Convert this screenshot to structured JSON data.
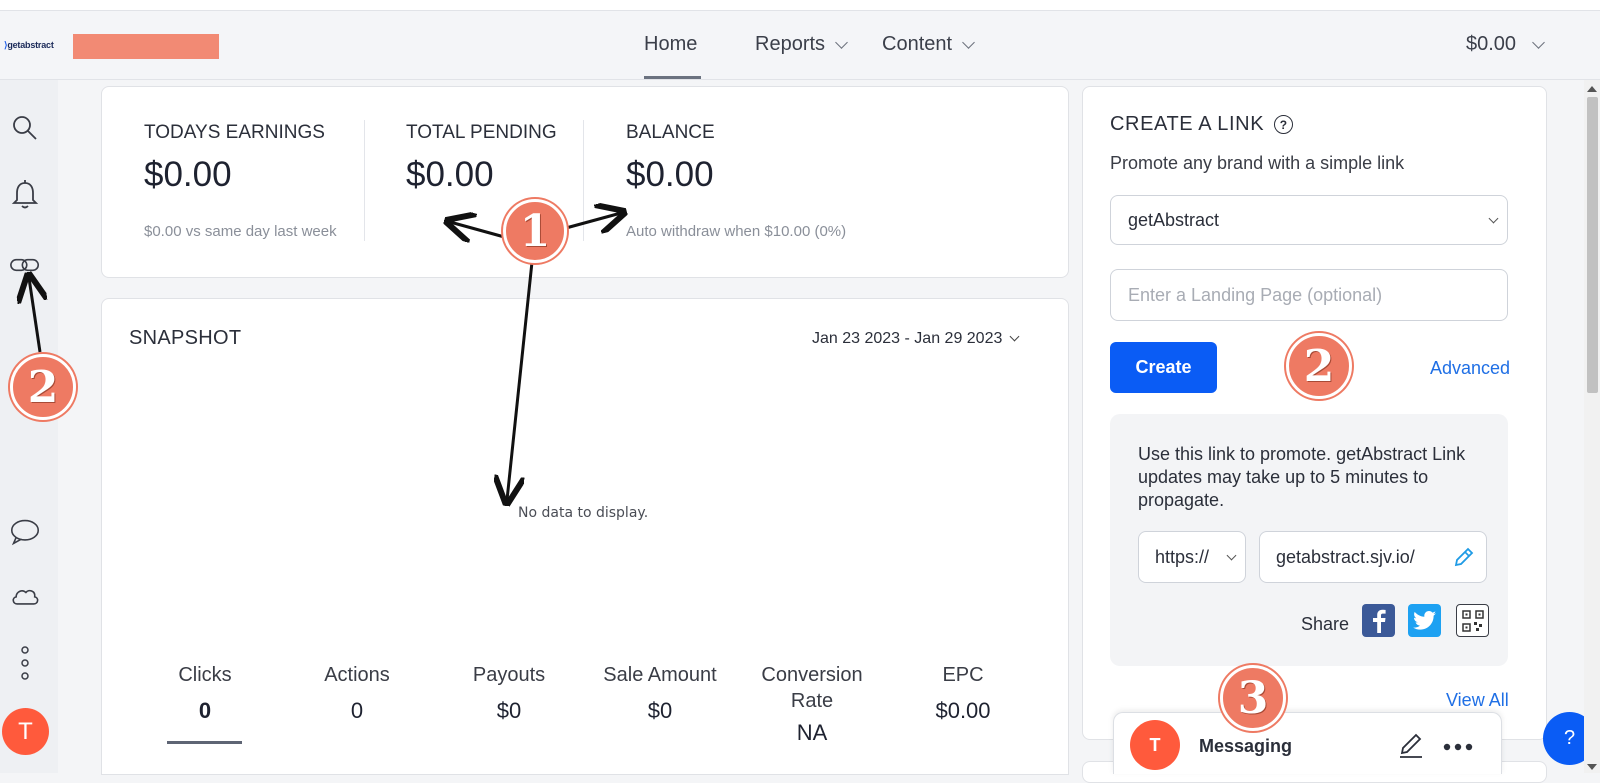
{
  "header": {
    "logo": "getabstract",
    "nav": [
      {
        "label": "Home",
        "active": true
      },
      {
        "label": "Reports"
      },
      {
        "label": "Content"
      }
    ],
    "balance": "$0.00"
  },
  "sidebar": {
    "icons": [
      "search-icon",
      "bell-icon",
      "link-icon",
      "chat-icon",
      "cloud-icon",
      "more-vertical-icon"
    ],
    "avatar_initial": "T"
  },
  "stats": {
    "todays_earnings": {
      "title": "TODAYS EARNINGS",
      "value": "$0.00",
      "sub": "$0.00 vs same day last week"
    },
    "total_pending": {
      "title": "TOTAL PENDING",
      "value": "$0.00"
    },
    "balance": {
      "title": "BALANCE",
      "value": "$0.00",
      "sub": "Auto withdraw when $10.00 (0%)"
    }
  },
  "snapshot": {
    "title": "SNAPSHOT",
    "date_range": "Jan 23 2023 - Jan 29 2023",
    "no_data": "No data to display.",
    "metrics": [
      {
        "label": "Clicks",
        "value": "0"
      },
      {
        "label": "Actions",
        "value": "0"
      },
      {
        "label": "Payouts",
        "value": "$0"
      },
      {
        "label": "Sale Amount",
        "value": "$0"
      },
      {
        "label": "Conversion Rate",
        "value": "NA"
      },
      {
        "label": "EPC",
        "value": "$0.00"
      }
    ]
  },
  "create_link": {
    "title": "CREATE A LINK",
    "help": "?",
    "subtitle": "Promote any brand with a simple link",
    "brand_selected": "getAbstract",
    "landing_placeholder": "Enter a Landing Page (optional)",
    "create_label": "Create",
    "advanced_label": "Advanced",
    "info": "Use this link to promote. getAbstract Link updates may take up to 5 minutes to propagate.",
    "protocol": "https://",
    "url": "getabstract.sjv.io/",
    "share_label": "Share",
    "view_all": "View All"
  },
  "messaging": {
    "avatar_initial": "T",
    "label": "Messaging"
  },
  "help_fab": "?",
  "annotations": {
    "badge1": "1",
    "badge2": "2",
    "badge3": "3"
  },
  "colors": {
    "primary": "#0a5cf5",
    "accent_orange": "#ff5a3c",
    "annotation": "#ee7a63",
    "link": "#1f6fe5"
  }
}
